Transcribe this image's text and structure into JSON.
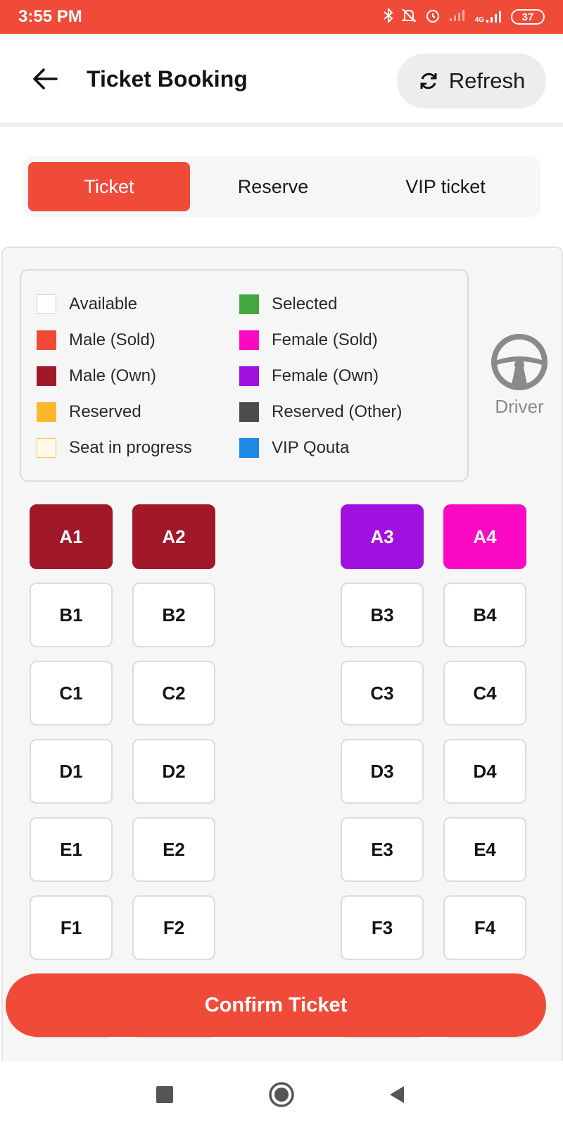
{
  "status_bar": {
    "time": "3:55 PM",
    "network": "4G",
    "battery": "37",
    "icons": [
      "bluetooth-icon",
      "mute-icon",
      "alarm-icon",
      "signal-icon",
      "signal-icon",
      "battery-icon"
    ]
  },
  "header": {
    "title": "Ticket Booking",
    "refresh_label": "Refresh"
  },
  "tabs": [
    {
      "label": "Ticket",
      "active": true
    },
    {
      "label": "Reserve",
      "active": false
    },
    {
      "label": "VIP ticket",
      "active": false
    }
  ],
  "legend": [
    {
      "label": "Available",
      "color": "#ffffff"
    },
    {
      "label": "Selected",
      "color": "#43a73f"
    },
    {
      "label": "Male (Sold)",
      "color": "#f04a38"
    },
    {
      "label": "Female (Sold)",
      "color": "#fb09c4"
    },
    {
      "label": "Male (Own)",
      "color": "#a11829"
    },
    {
      "label": "Female (Own)",
      "color": "#a010df"
    },
    {
      "label": "Reserved",
      "color": "#fdb72c"
    },
    {
      "label": "Reserved (Other)",
      "color": "#4c4c4c"
    },
    {
      "label": "Seat in progress",
      "color": "#fff8e9"
    },
    {
      "label": "VIP Qouta",
      "color": "#1e88e5"
    }
  ],
  "driver": {
    "label": "Driver"
  },
  "seats": [
    [
      {
        "label": "A1",
        "status": "male-own"
      },
      {
        "label": "A2",
        "status": "male-own"
      },
      {
        "label": "A3",
        "status": "female-own"
      },
      {
        "label": "A4",
        "status": "female-sold"
      }
    ],
    [
      {
        "label": "B1",
        "status": "available"
      },
      {
        "label": "B2",
        "status": "available"
      },
      {
        "label": "B3",
        "status": "available"
      },
      {
        "label": "B4",
        "status": "available"
      }
    ],
    [
      {
        "label": "C1",
        "status": "available"
      },
      {
        "label": "C2",
        "status": "available"
      },
      {
        "label": "C3",
        "status": "available"
      },
      {
        "label": "C4",
        "status": "available"
      }
    ],
    [
      {
        "label": "D1",
        "status": "available"
      },
      {
        "label": "D2",
        "status": "available"
      },
      {
        "label": "D3",
        "status": "available"
      },
      {
        "label": "D4",
        "status": "available"
      }
    ],
    [
      {
        "label": "E1",
        "status": "available"
      },
      {
        "label": "E2",
        "status": "available"
      },
      {
        "label": "E3",
        "status": "available"
      },
      {
        "label": "E4",
        "status": "available"
      }
    ],
    [
      {
        "label": "F1",
        "status": "available"
      },
      {
        "label": "F2",
        "status": "available"
      },
      {
        "label": "F3",
        "status": "available"
      },
      {
        "label": "F4",
        "status": "available"
      }
    ]
  ],
  "confirm_label": "Confirm Ticket",
  "nav_bar": {
    "buttons": [
      "recent-apps-icon",
      "home-icon",
      "back-nav-icon"
    ]
  }
}
